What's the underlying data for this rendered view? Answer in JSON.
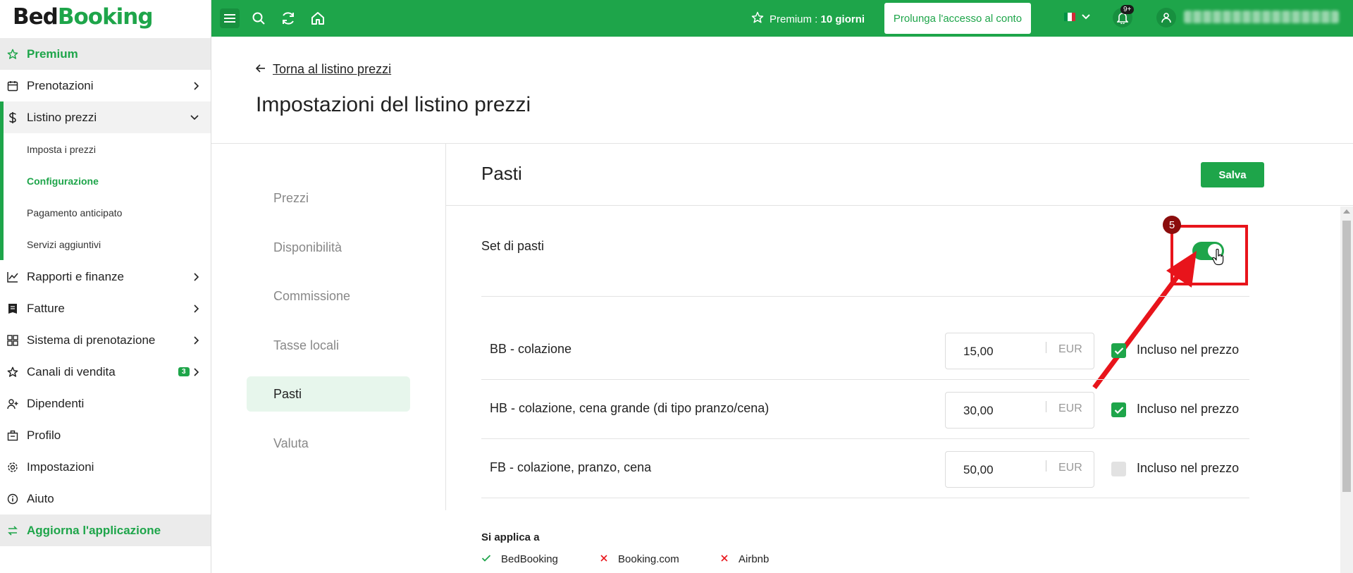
{
  "app": {
    "logo_part1": "Bed",
    "logo_part2": "Booking"
  },
  "topbar": {
    "premium_label": "Premium :",
    "premium_value": "10 giorni",
    "prolong_button": "Prolunga l'accesso al conto",
    "notifications_badge": "9+",
    "flag_colors": [
      "#009246",
      "#ffffff",
      "#ce2b37"
    ]
  },
  "sidebar": {
    "premium": "Premium",
    "prenotazioni": "Prenotazioni",
    "listino_prezzi": "Listino prezzi",
    "sub_items": [
      "Imposta i prezzi",
      "Configurazione",
      "Pagamento anticipato",
      "Servizi aggiuntivi"
    ],
    "rapporti": "Rapporti e finanze",
    "fatture": "Fatture",
    "sistema": "Sistema di prenotazione",
    "canali": "Canali di vendita",
    "canali_badge": "3",
    "dipendenti": "Dipendenti",
    "profilo": "Profilo",
    "impostazioni": "Impostazioni",
    "aiuto": "Aiuto",
    "aggiorna": "Aggiorna l'applicazione"
  },
  "header": {
    "back_link": "Torna al listino prezzi",
    "title": "Impostazioni del listino prezzi"
  },
  "settings_nav": [
    "Prezzi",
    "Disponibilità",
    "Commissione",
    "Tasse locali",
    "Pasti",
    "Valuta"
  ],
  "panel": {
    "title": "Pasti",
    "save_button": "Salva",
    "set_label": "Set di pasti",
    "set_enabled": true,
    "step_number": "5",
    "meals": [
      {
        "name": "BB - colazione",
        "price": "15,00",
        "currency": "EUR",
        "included": true,
        "included_label": "Incluso nel prezzo"
      },
      {
        "name": "HB - colazione, cena grande (di tipo pranzo/cena)",
        "price": "30,00",
        "currency": "EUR",
        "included": true,
        "included_label": "Incluso nel prezzo"
      },
      {
        "name": "FB - colazione, pranzo, cena",
        "price": "50,00",
        "currency": "EUR",
        "included": false,
        "included_label": "Incluso nel prezzo"
      }
    ],
    "applies_to_title": "Si applica a",
    "applies_to": [
      {
        "name": "BedBooking",
        "enabled": true
      },
      {
        "name": "Booking.com",
        "enabled": false
      },
      {
        "name": "Airbnb",
        "enabled": false
      }
    ]
  },
  "colors": {
    "brand_green": "#1ea54a",
    "annotation_red": "#e8141b"
  }
}
